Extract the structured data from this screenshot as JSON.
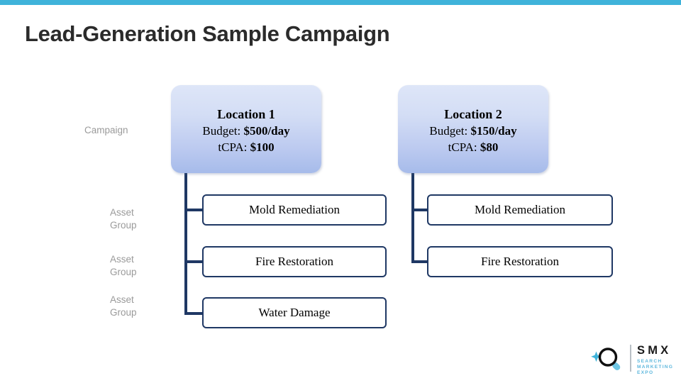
{
  "theme": {
    "accent_bar_color": "#3FB3DA",
    "title_color": "#2B2B2B",
    "label_color": "#9A9A9A",
    "box_border_color": "#1F3864",
    "card_gradient_top": "#DEE6F8",
    "card_gradient_bottom": "#A6BBEA",
    "logo_blue": "#5FB8DD"
  },
  "slide": {
    "title": "Lead-Generation Sample Campaign"
  },
  "labels": {
    "campaign": "Campaign",
    "asset_group": "Asset\nGroup"
  },
  "campaigns": [
    {
      "name": "Location 1",
      "budget_label": "Budget:",
      "budget_value": "$500/day",
      "tcpa_label": "tCPA:",
      "tcpa_value": "$100",
      "asset_groups": [
        "Mold Remediation",
        "Fire Restoration",
        "Water Damage"
      ]
    },
    {
      "name": "Location 2",
      "budget_label": "Budget:",
      "budget_value": "$150/day",
      "tcpa_label": "tCPA:",
      "tcpa_value": "$80",
      "asset_groups": [
        "Mold Remediation",
        "Fire Restoration"
      ]
    }
  ],
  "logo": {
    "wordmark": "SMX",
    "tagline": "SEARCH\nMARKETING\nEXPO"
  }
}
